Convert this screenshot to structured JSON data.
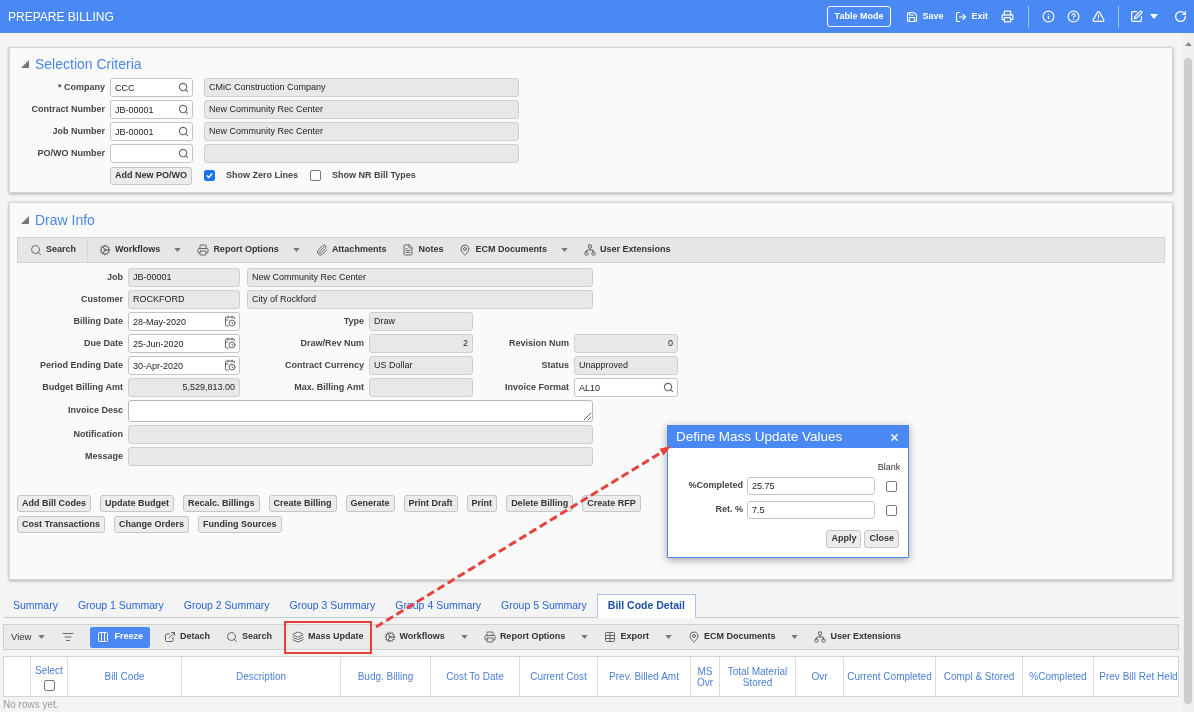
{
  "header": {
    "title": "PREPARE BILLING",
    "actions": [
      {
        "kind": "outlined",
        "label": "Table Mode"
      },
      {
        "kind": "icon-text",
        "label": "Save"
      },
      {
        "kind": "icon-text",
        "label": "Exit"
      }
    ]
  },
  "selection_criteria": {
    "title": "Selection Criteria",
    "fields": [
      {
        "label": "* Company",
        "value": "CCC",
        "description": "CMiC Construction Company"
      },
      {
        "label": "Contract Number",
        "value": "JB-00001",
        "description": "New Community Rec Center"
      },
      {
        "label": "Job Number",
        "value": "JB-00001",
        "description": "New Community Rec Center"
      },
      {
        "label": "PO/WO Number"
      }
    ],
    "button": "Add New PO/WO",
    "options": [
      {
        "label": "Show Zero Lines",
        "checked": true
      },
      {
        "label": "Show NR Bill Types",
        "checked": false
      }
    ]
  },
  "draw_info": {
    "title": "Draw Info",
    "toolbar": [
      {
        "label": "Search",
        "dropdown": false
      },
      {
        "label": "Workflows",
        "dropdown": true
      },
      {
        "label": "Report Options",
        "dropdown": true
      },
      {
        "label": "Attachments",
        "dropdown": false
      },
      {
        "label": "Notes",
        "dropdown": false
      },
      {
        "label": "ECM Documents",
        "dropdown": true
      },
      {
        "label": "User Extensions",
        "dropdown": false
      }
    ],
    "header_fields": [
      {
        "label": "Job",
        "value": "JB-00001",
        "description": "New Community Rec Center"
      },
      {
        "label": "Customer",
        "value": "ROCKFORD",
        "description": "City of Rockford"
      }
    ],
    "field_rows": [
      [
        {
          "kind": "date",
          "label": "Billing Date",
          "value": "28-May-2020"
        },
        {
          "kind": "readonly",
          "label": "Type",
          "value": "Draw"
        }
      ],
      [
        {
          "kind": "date",
          "label": "Due Date",
          "value": "25-Jun-2020"
        },
        {
          "kind": "number",
          "label": "Draw/Rev Num",
          "value": "2"
        },
        {
          "kind": "number",
          "label": "Revision Num",
          "value": "0"
        }
      ],
      [
        {
          "kind": "date",
          "label": "Period Ending Date",
          "value": "30-Apr-2020"
        },
        {
          "kind": "readonly",
          "label": "Contract Currency",
          "value": "US Dollar"
        },
        {
          "kind": "readonly",
          "label": "Status",
          "value": "Unapproved"
        }
      ],
      [
        {
          "kind": "number",
          "label": "Budget Billing Amt",
          "value": "5,529,813.00"
        },
        {
          "kind": "number",
          "label": "Max. Billing Amt"
        },
        {
          "kind": "lookup",
          "label": "Invoice Format",
          "value": "AL10"
        }
      ]
    ],
    "wide_fields": [
      {
        "kind": "textarea",
        "label": "Invoice Desc"
      },
      {
        "kind": "readonly",
        "label": "Notification"
      },
      {
        "kind": "readonly",
        "label": "Message"
      }
    ],
    "button_rows": [
      [
        "Add Bill Codes",
        "Update Budget",
        "Recalc. Billings",
        "Create Billing",
        "Generate",
        "Print Draft",
        "Print",
        "Delete Billing",
        "Create RFP"
      ],
      [
        "Cost Transactions",
        "Change Orders",
        "Funding Sources"
      ]
    ]
  },
  "tabs": [
    {
      "label": "Summary",
      "selected": false
    },
    {
      "label": "Group 1 Summary",
      "selected": false
    },
    {
      "label": "Group 2 Summary",
      "selected": false
    },
    {
      "label": "Group 3 Summary",
      "selected": false
    },
    {
      "label": "Group 4 Summary",
      "selected": false
    },
    {
      "label": "Group 5 Summary",
      "selected": false
    },
    {
      "label": "Bill Code Detail",
      "selected": true
    }
  ],
  "bottom_toolbar": [
    {
      "kind": "menu",
      "label": "View"
    },
    {
      "kind": "icon"
    },
    {
      "kind": "primary",
      "label": "Freeze"
    },
    {
      "kind": "tool",
      "label": "Detach",
      "dropdown": false,
      "highlighted": false
    },
    {
      "kind": "tool",
      "label": "Search",
      "dropdown": false,
      "highlighted": false
    },
    {
      "kind": "tool",
      "label": "Mass Update",
      "dropdown": false,
      "highlighted": true
    },
    {
      "kind": "tool",
      "label": "Workflows",
      "dropdown": true,
      "highlighted": false
    },
    {
      "kind": "tool",
      "label": "Report Options",
      "dropdown": true,
      "highlighted": false
    },
    {
      "kind": "tool",
      "label": "Export",
      "dropdown": true,
      "highlighted": false
    },
    {
      "kind": "tool",
      "label": "ECM Documents",
      "dropdown": true,
      "highlighted": false
    },
    {
      "kind": "tool",
      "label": "User Extensions",
      "dropdown": false,
      "highlighted": false
    }
  ],
  "grid": {
    "select_column": {
      "label": "Select",
      "checked": false
    },
    "columns": [
      "Bill Code",
      "Description",
      "Budg. Billing",
      "Cost To Date",
      "Current Cost",
      "Prev. Billed Amt",
      "MS Ovr",
      "Total Material Stored",
      "Ovr",
      "Current Completed",
      "Compl & Stored",
      "%Completed",
      "Prev Bill Ret Held"
    ],
    "empty_message": "No rows yet."
  },
  "dialog": {
    "title": "Define Mass Update Values",
    "column_header": "Blank",
    "fields": [
      {
        "label": "%Completed",
        "value": "25.75",
        "blank": false
      },
      {
        "label": "Ret. %",
        "value": "7.5",
        "blank": false
      }
    ],
    "buttons": [
      "Apply",
      "Close"
    ]
  }
}
